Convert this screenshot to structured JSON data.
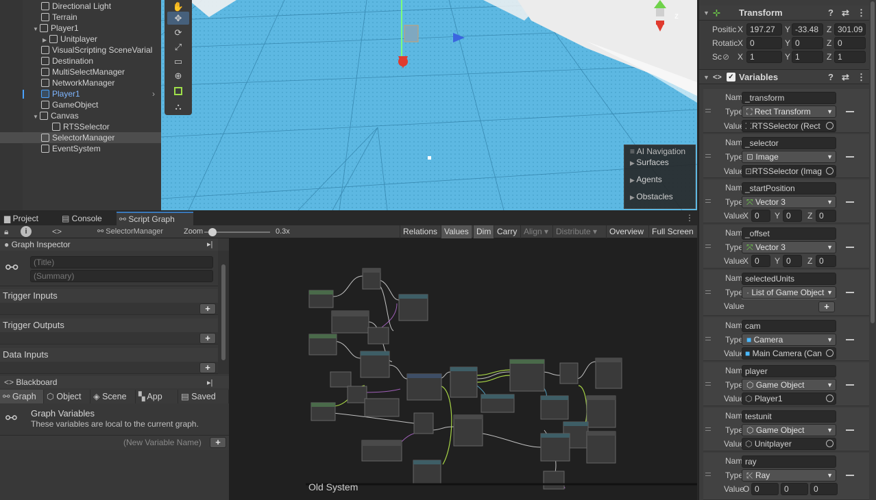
{
  "hierarchy": {
    "items": [
      {
        "label": "Directional Light"
      },
      {
        "label": "Terrain"
      },
      {
        "label": "Player1"
      },
      {
        "label": "Unitplayer"
      },
      {
        "label": "VisualScripting SceneVarial"
      },
      {
        "label": "Destination"
      },
      {
        "label": "MultiSelectManager"
      },
      {
        "label": "NetworkManager"
      },
      {
        "label": "Player1"
      },
      {
        "label": "GameObject"
      },
      {
        "label": "Canvas"
      },
      {
        "label": "RTSSelector"
      },
      {
        "label": "SelectorManager"
      },
      {
        "label": "EventSystem"
      }
    ]
  },
  "scene": {
    "ai_navigation": {
      "title": "AI Navigation",
      "items": [
        "Surfaces",
        "Agents",
        "Obstacles"
      ]
    },
    "gizmo_axis": "z"
  },
  "bottom_tabs": [
    "Project",
    "Console",
    "Script Graph"
  ],
  "graph_toolbar": {
    "asset": "SelectorManager",
    "zoom_label": "Zoom",
    "zoom_value": "0.3x",
    "zoom_fraction": 0.12,
    "buttons": [
      "Relations",
      "Values",
      "Dim",
      "Carry",
      "Align",
      "Distribute",
      "Overview",
      "Full Screen"
    ]
  },
  "graph_inspector": {
    "title": "Graph Inspector",
    "title_placeholder": "(Title)",
    "summary_placeholder": "(Summary)",
    "sections": [
      "Trigger Inputs",
      "Trigger Outputs",
      "Data Inputs"
    ]
  },
  "blackboard": {
    "title": "Blackboard",
    "tabs": [
      "Graph",
      "Object",
      "Scene",
      "App",
      "Saved"
    ],
    "heading": "Graph Variables",
    "description": "These variables are local to the current graph.",
    "new_var_placeholder": "(New Variable Name)"
  },
  "graph": {
    "group_label": "Old System"
  },
  "inspector": {
    "transform": {
      "title": "Transform",
      "rows": [
        {
          "label": "Positic",
          "x": "197.27",
          "y": "-33.48",
          "z": "301.09"
        },
        {
          "label": "Rotatic",
          "x": "0",
          "y": "0",
          "z": "0"
        },
        {
          "label": "Sc",
          "x": "1",
          "y": "1",
          "z": "1"
        }
      ]
    },
    "variables_title": "Variables",
    "labels": {
      "name": "Name",
      "type": "Type",
      "value": "Value"
    },
    "variables": [
      {
        "name": "_transform",
        "type": "Rect Transform",
        "value": "RTSSelector (Rect"
      },
      {
        "name": "_selector",
        "type": "Image",
        "value": "RTSSelector (Imag"
      },
      {
        "name": "_startPosition",
        "type": "Vector 3",
        "x": "0",
        "y": "0",
        "z": "0"
      },
      {
        "name": "_offset",
        "type": "Vector 3",
        "x": "0",
        "y": "0",
        "z": "0"
      },
      {
        "name": "selectedUnits",
        "type": "List of Game Object"
      },
      {
        "name": "cam",
        "type": "Camera",
        "value": "Main Camera (Can"
      },
      {
        "name": "player",
        "type": "Game Object",
        "value": "Player1"
      },
      {
        "name": "testunit",
        "type": "Game Object",
        "value": "Unitplayer"
      },
      {
        "name": "ray",
        "type": "Ray",
        "o1": "0",
        "o2": "0",
        "o3": "0",
        "o_label": "O"
      }
    ]
  }
}
